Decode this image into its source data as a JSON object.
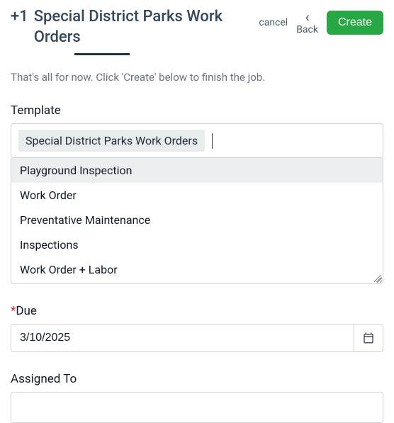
{
  "header": {
    "prefix": "+1",
    "title": "Special District Parks Work Orders",
    "cancel": "cancel",
    "back": "Back",
    "create": "Create"
  },
  "instruction": "That's all for now. Click 'Create' below to finish the job.",
  "template": {
    "label": "Template",
    "selected_chip": "Special District Parks Work Orders",
    "options": [
      "Playground Inspection",
      "Work Order",
      "Preventative Maintenance",
      "Inspections",
      "Work Order + Labor"
    ],
    "highlighted_index": 0
  },
  "due": {
    "label": "Due",
    "required": true,
    "value": "3/10/2025",
    "icon_name": "calendar-icon"
  },
  "assigned": {
    "label": "Assigned To",
    "value": ""
  }
}
